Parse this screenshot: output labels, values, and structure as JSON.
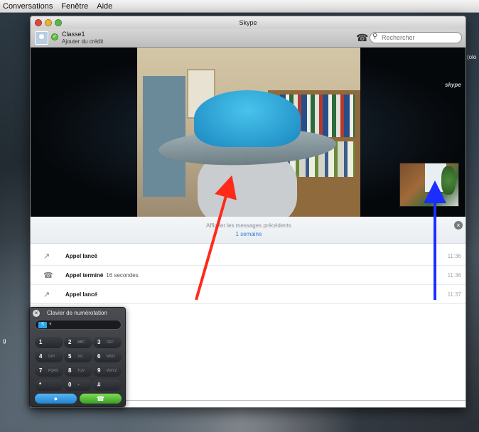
{
  "menu": {
    "items": [
      "Conversations",
      "Fenêtre",
      "Aide"
    ]
  },
  "window": {
    "title": "Skype"
  },
  "toolbar": {
    "user_name": "Classe1",
    "credit_link": "Ajouter du crédit",
    "search_placeholder": "Rechercher"
  },
  "video": {
    "logo_text": "skype"
  },
  "history": {
    "show_previous": "Afficher les messages précédents",
    "period": "1 semaine"
  },
  "messages": [
    {
      "title": "Appel lancé",
      "detail": "",
      "time": "11:36",
      "icon": "call-out-icon"
    },
    {
      "title": "Appel terminé",
      "detail": "16 secondes",
      "time": "11:36",
      "icon": "call-end-icon"
    },
    {
      "title": "Appel lancé",
      "detail": "",
      "time": "11:37",
      "icon": "call-out-icon"
    }
  ],
  "dialpad": {
    "title": "Clavier de numérotation",
    "country_flag": "S",
    "keys": [
      {
        "main": "1",
        "sub": ""
      },
      {
        "main": "2",
        "sub": "ABC"
      },
      {
        "main": "3",
        "sub": "DEF"
      },
      {
        "main": "4",
        "sub": "GHI"
      },
      {
        "main": "5",
        "sub": "JKL"
      },
      {
        "main": "6",
        "sub": "MNO"
      },
      {
        "main": "7",
        "sub": "PQRS"
      },
      {
        "main": "8",
        "sub": "TUV"
      },
      {
        "main": "9",
        "sub": "WXYZ"
      },
      {
        "main": "*",
        "sub": ""
      },
      {
        "main": "0",
        "sub": "+"
      },
      {
        "main": "#",
        "sub": ""
      }
    ]
  },
  "desktop": {
    "edge_text": "(olo",
    "left_text": "g"
  },
  "colors": {
    "arrow_red": "#ff2a1a",
    "arrow_blue": "#1a2fff",
    "skype_blue": "#2a7fd1",
    "call_green": "#3a9d26"
  }
}
